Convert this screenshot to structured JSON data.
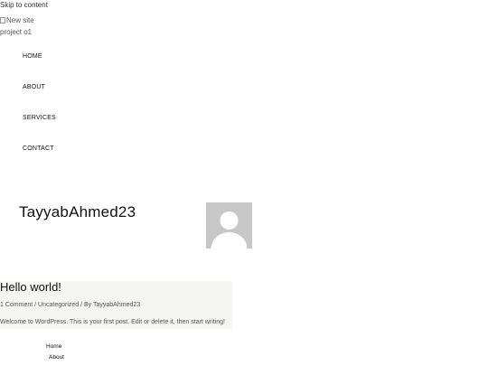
{
  "skip_link": "Skip to content",
  "logo": {
    "alt_text_line1": "New site",
    "alt_text_line2": "project o1"
  },
  "main_nav": {
    "items": [
      {
        "label": "HOME"
      },
      {
        "label": "ABOUT"
      },
      {
        "label": "SERVICES"
      },
      {
        "label": "CONTACT"
      }
    ]
  },
  "author": {
    "name": "TayyabAhmed23",
    "avatar_icon": "default-user-avatar"
  },
  "post": {
    "title": "Hello world!",
    "comments": "1 Comment",
    "sep1": " / ",
    "category": "Uncategorized",
    "sep2": " / By ",
    "author": "TayyabAhmed23",
    "excerpt": "Welcome to WordPress. This is your first post. Edit or delete it, then start writing!"
  },
  "footer_nav": {
    "items": [
      {
        "label": "Home"
      },
      {
        "label": "About"
      }
    ]
  },
  "colors": {
    "card_background": "#f5f5f3",
    "avatar_background": "#c7c7c7",
    "text": "#111111",
    "muted_text": "#555555"
  }
}
